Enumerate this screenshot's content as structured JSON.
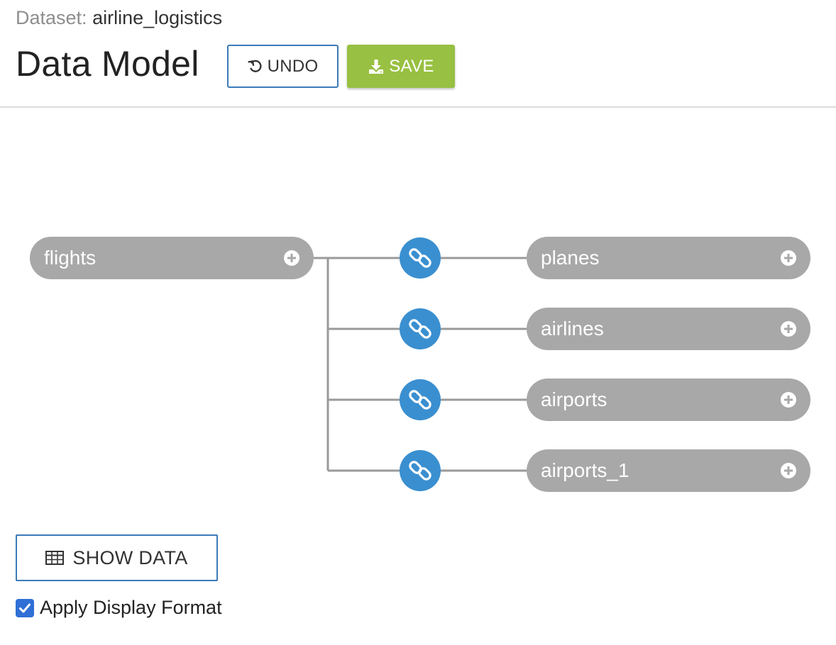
{
  "header": {
    "dataset_label": "Dataset:",
    "dataset_name": "airline_logistics",
    "title": "Data Model"
  },
  "toolbar": {
    "undo_label": "UNDO",
    "save_label": "SAVE"
  },
  "model": {
    "root": {
      "label": "flights"
    },
    "joins": [
      {
        "label": "planes"
      },
      {
        "label": "airlines"
      },
      {
        "label": "airports"
      },
      {
        "label": "airports_1"
      }
    ]
  },
  "controls": {
    "show_data_label": "SHOW DATA",
    "apply_display_format_label": "Apply Display Format",
    "apply_display_format_checked": true
  },
  "colors": {
    "node_fill": "#a8a8a8",
    "link_fill": "#3a8fd0",
    "save_fill": "#98c042",
    "outline_blue": "#3b7ab8",
    "connector_line": "#9a9a9a",
    "checkbox_fill": "#2f6fd6"
  },
  "icons": {
    "undo": "undo-icon",
    "save": "download-icon",
    "add": "plus-circle-icon",
    "link": "chain-link-icon",
    "table": "table-icon",
    "checkbox": "checkmark-icon"
  }
}
